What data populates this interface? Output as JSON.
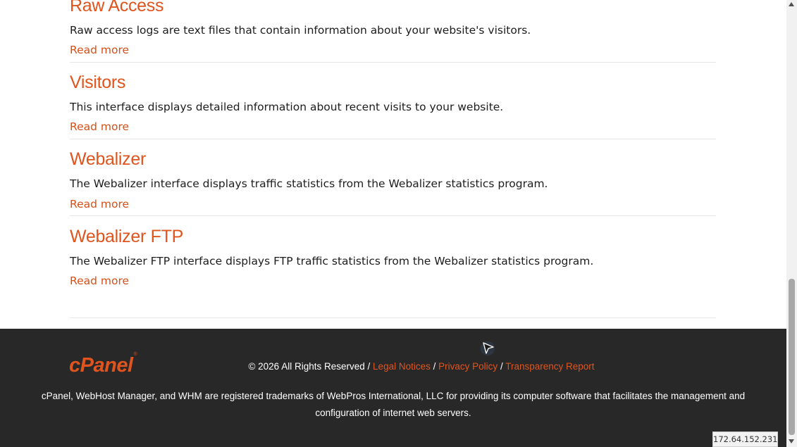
{
  "sections": [
    {
      "title": "Raw Access",
      "description": "Raw access logs are text files that contain information about your website's visitors.",
      "read_more": "Read more"
    },
    {
      "title": "Visitors",
      "description": "This interface displays detailed information about recent visits to your website.",
      "read_more": "Read more"
    },
    {
      "title": "Webalizer",
      "description": "The Webalizer interface displays traffic statistics from the Webalizer statistics program.",
      "read_more": "Read more"
    },
    {
      "title": "Webalizer FTP",
      "description": "The Webalizer FTP interface displays FTP traffic statistics from the Webalizer statistics program.",
      "read_more": "Read more"
    }
  ],
  "footer": {
    "logo_text": "cPanel",
    "logo_mark": "®",
    "copyright": "© 2026 All Rights Reserved",
    "separator": "/",
    "legal_notices": "Legal Notices",
    "privacy_policy": "Privacy Policy",
    "transparency_report": "Transparency Report",
    "trademark": "cPanel, WebHost Manager, and WHM are registered trademarks of WebPros International, LLC for providing its computer software that facilitates the management and configuration of internet web servers."
  },
  "ip_address": "172.64.152.231",
  "colors": {
    "accent": "#e0541e",
    "footer_bg": "#282828",
    "text": "#1d1d1d"
  },
  "icons": {
    "cursor": "mouse-pointer-icon",
    "scroll_up": "triangle-up-icon",
    "scroll_down": "triangle-down-icon"
  }
}
